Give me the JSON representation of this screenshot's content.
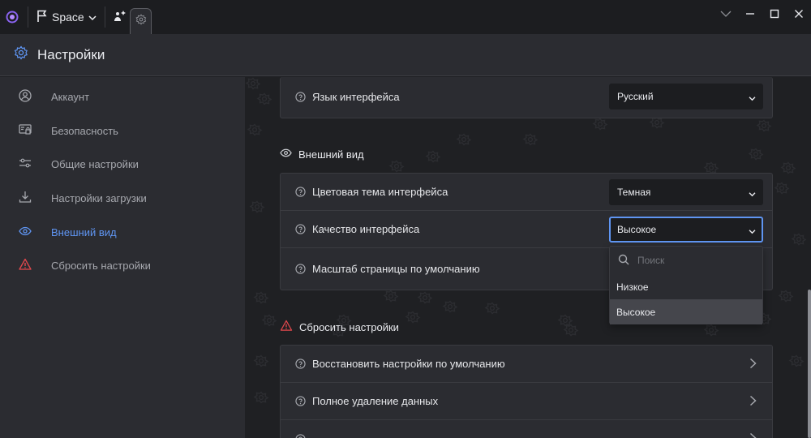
{
  "window": {
    "space_label": "Space"
  },
  "header": {
    "title": "Настройки"
  },
  "sidebar": {
    "items": [
      {
        "label": "Аккаунт",
        "icon": "user-circle-icon"
      },
      {
        "label": "Безопасность",
        "icon": "security-icon"
      },
      {
        "label": "Общие настройки",
        "icon": "sliders-icon"
      },
      {
        "label": "Настройки загрузки",
        "icon": "download-icon"
      },
      {
        "label": "Внешний вид",
        "icon": "eye-icon",
        "active": true
      },
      {
        "label": "Сбросить настройки",
        "icon": "warning-icon"
      }
    ]
  },
  "language": {
    "label": "Язык интерфейса",
    "value": "Русский"
  },
  "appearance": {
    "title": "Внешний вид",
    "theme": {
      "label": "Цветовая тема интерфейса",
      "value": "Темная"
    },
    "quality": {
      "label": "Качество интерфейса",
      "value": "Высокое"
    },
    "scale": {
      "label": "Масштаб страницы по умолчанию"
    }
  },
  "dropdown": {
    "search_placeholder": "Поиск",
    "options": [
      "Низкое",
      "Высокое"
    ],
    "selected": "Высокое"
  },
  "reset": {
    "title": "Сбросить настройки",
    "items": [
      {
        "label": "Восстановить настройки по умолчанию"
      },
      {
        "label": "Полное удаление данных"
      }
    ]
  },
  "colors": {
    "accent": "#5f95f2",
    "warning": "#e5484d",
    "panel": "#2b2c31",
    "background": "#1f2023"
  }
}
